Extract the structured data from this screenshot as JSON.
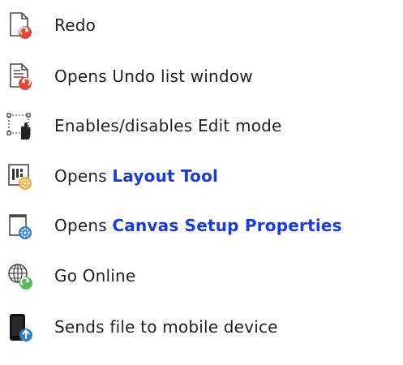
{
  "rows": [
    {
      "icon": "redo-icon",
      "text": "Redo"
    },
    {
      "icon": "undo-list-icon",
      "text": "Opens Undo list window"
    },
    {
      "icon": "edit-mode-icon",
      "text": "Enables/disables Edit mode"
    },
    {
      "icon": "layout-tool-icon",
      "prefix": "Opens",
      "link": "Layout Tool"
    },
    {
      "icon": "canvas-setup-icon",
      "prefix": "Opens",
      "link": "Canvas Setup Properties"
    },
    {
      "icon": "go-online-icon",
      "text": "Go Online"
    },
    {
      "icon": "send-to-mobile-icon",
      "text": "Sends file to mobile device"
    }
  ],
  "colors": {
    "text": "#1f1f1f",
    "link": "#1a3be0",
    "red_badge": "#e0483a",
    "green_badge": "#5cb85c",
    "blue_badge": "#2d7fd3",
    "orange_badge": "#f2a93b"
  }
}
